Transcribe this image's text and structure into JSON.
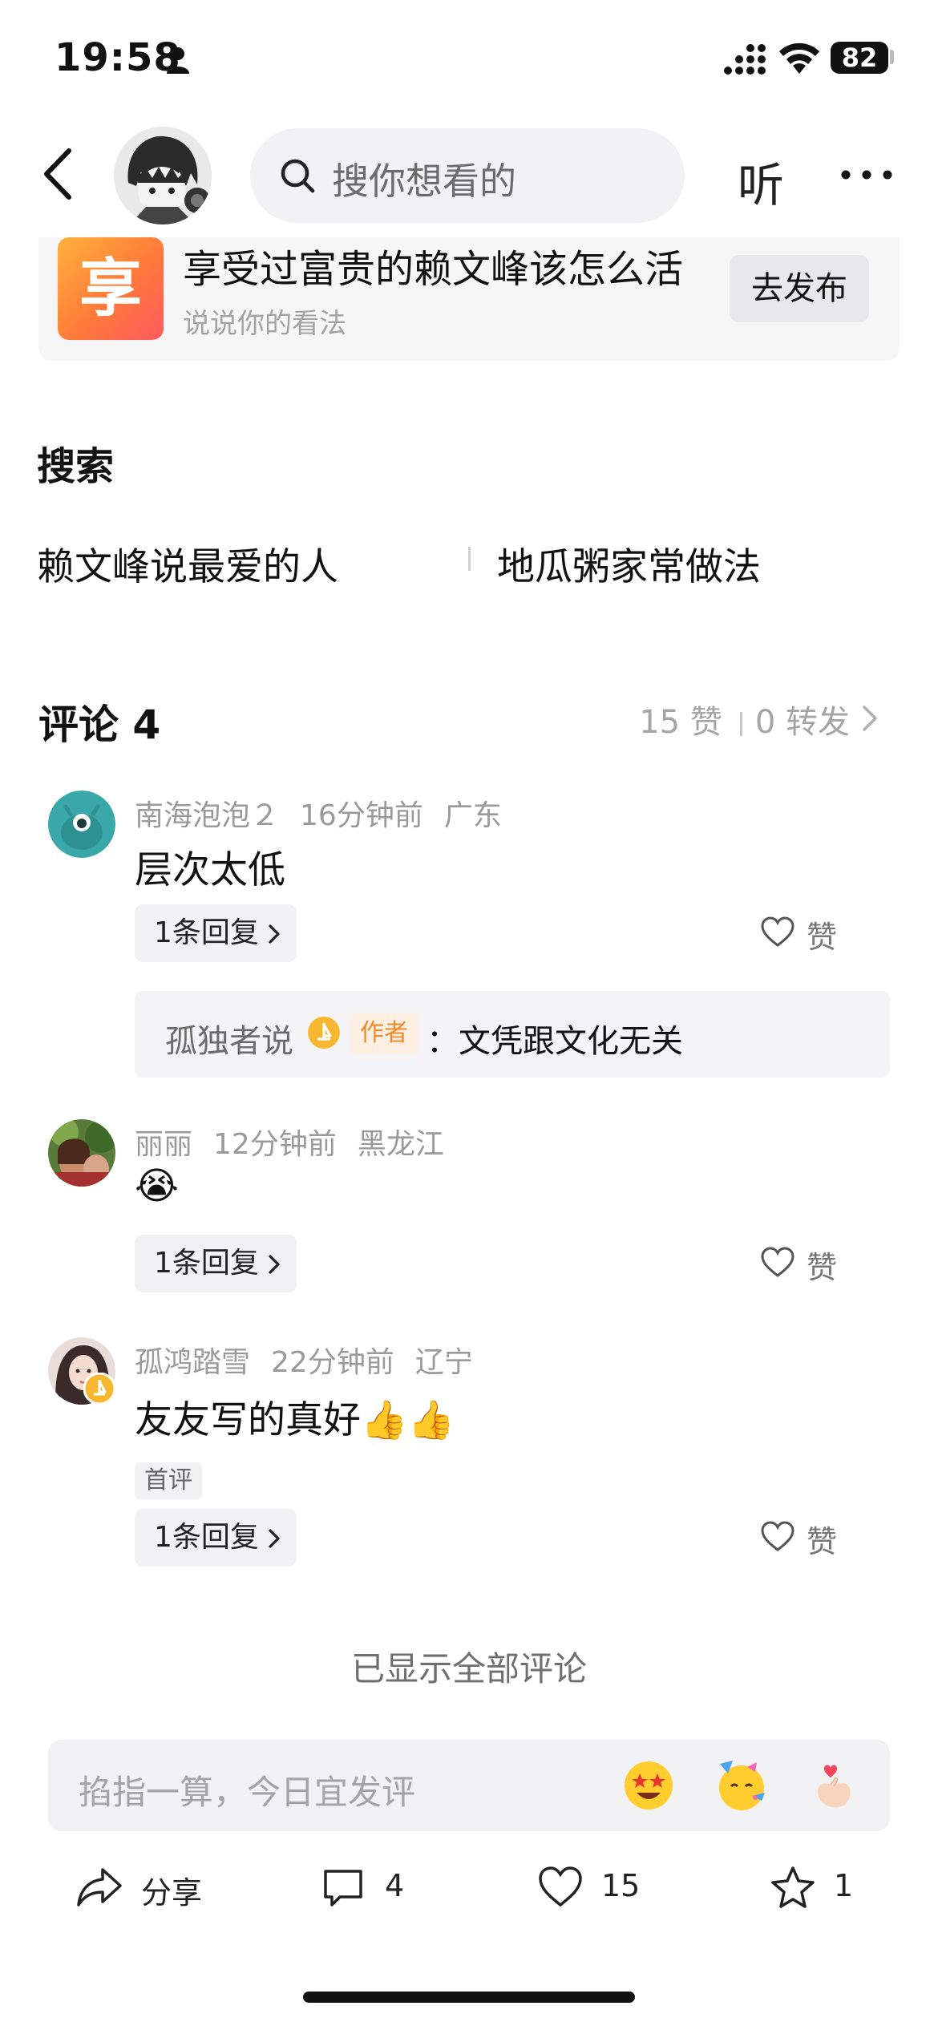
{
  "status_bar": {
    "time": "19:58",
    "battery": "82"
  },
  "nav": {
    "search_placeholder": "搜你想看的",
    "listen_label": "听"
  },
  "topic": {
    "icon_char": "享",
    "title": "享受过富贵的赖文峰该怎么活",
    "subtitle": "说说你的看法",
    "publish_label": "去发布"
  },
  "search_section": {
    "heading": "搜索",
    "items": [
      "赖文峰说最爱的人",
      "地瓜粥家常做法"
    ]
  },
  "comments": {
    "title": "评论 4",
    "likes": "15 赞",
    "reposts": "0 转发",
    "items": [
      {
        "user": "南海泡泡２",
        "time": "16分钟前",
        "location": "广东",
        "text": "层次太低",
        "reply_label": "1条回复",
        "like_label": "赞",
        "quote": {
          "name": "孤独者说",
          "tag": "作者",
          "text": "：文凭跟文化无关"
        }
      },
      {
        "user": "丽丽",
        "time": "12分钟前",
        "location": "黑龙江",
        "text": "😭",
        "reply_label": "1条回复",
        "like_label": "赞"
      },
      {
        "user": "孤鸿踏雪",
        "time": "22分钟前",
        "location": "辽宁",
        "text": "友友写的真好👍👍",
        "tag": "首评",
        "reply_label": "1条回复",
        "like_label": "赞"
      }
    ],
    "all_shown": "已显示全部评论"
  },
  "input_bar": {
    "placeholder": "掐指一算，今日宜发评"
  },
  "actions": {
    "share": "分享",
    "comment_count": "4",
    "like_count": "15",
    "favorite_count": "1"
  }
}
